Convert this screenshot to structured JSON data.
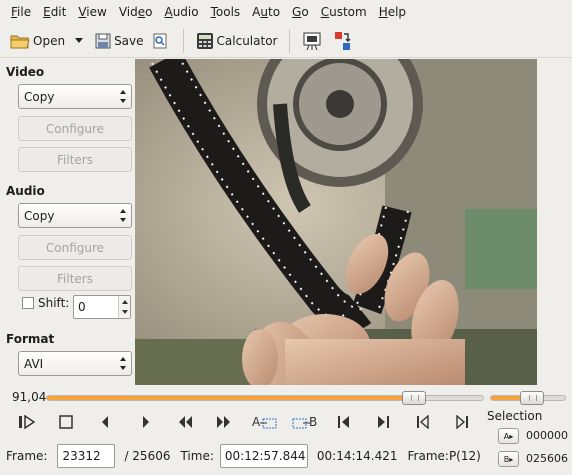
{
  "menu": {
    "items": [
      {
        "acc": "F",
        "rest": "ile"
      },
      {
        "acc": "E",
        "rest": "dit"
      },
      {
        "acc": "V",
        "rest": "iew"
      },
      {
        "pre": "Vid",
        "acc": "e",
        "rest": "o"
      },
      {
        "acc": "A",
        "rest": "udio"
      },
      {
        "acc": "T",
        "rest": "ools"
      },
      {
        "pre": "A",
        "acc": "u",
        "rest": "to"
      },
      {
        "acc": "G",
        "rest": "o"
      },
      {
        "acc": "C",
        "rest": "ustom"
      },
      {
        "acc": "H",
        "rest": "elp"
      }
    ]
  },
  "toolbar": {
    "open_label": "Open",
    "save_label": "Save",
    "calculator_label": "Calculator"
  },
  "video": {
    "title": "Video",
    "codec": "Copy",
    "configure": "Configure",
    "filters": "Filters"
  },
  "audio": {
    "title": "Audio",
    "codec": "Copy",
    "configure": "Configure",
    "filters": "Filters",
    "shift_label": "Shift:",
    "shift_value": "0"
  },
  "format": {
    "title": "Format",
    "value": "AVI"
  },
  "seek": {
    "position_label": "91,04",
    "progress": 0.8417
  },
  "volume": {
    "level": 0.55
  },
  "status": {
    "frame_label": "Frame:",
    "frame_value": "23312",
    "frame_total": "/ 25606",
    "time_label": "Time:",
    "time_value": "00:12:57.844",
    "duration": "00:14:14.421",
    "frame_type": "Frame:P(12)"
  },
  "selection": {
    "title": "Selection",
    "a_label": "A",
    "a_value": "000000",
    "b_label": "B",
    "b_value": "025606"
  },
  "icons": [
    "play-icon",
    "stop-icon",
    "previous-frame-icon",
    "next-frame-icon",
    "rewind-icon",
    "fast-forward-icon",
    "set-marker-a-icon",
    "set-marker-b-icon",
    "previous-keyframe-icon",
    "next-keyframe-icon",
    "go-to-marker-a-icon",
    "go-to-marker-b-icon"
  ]
}
